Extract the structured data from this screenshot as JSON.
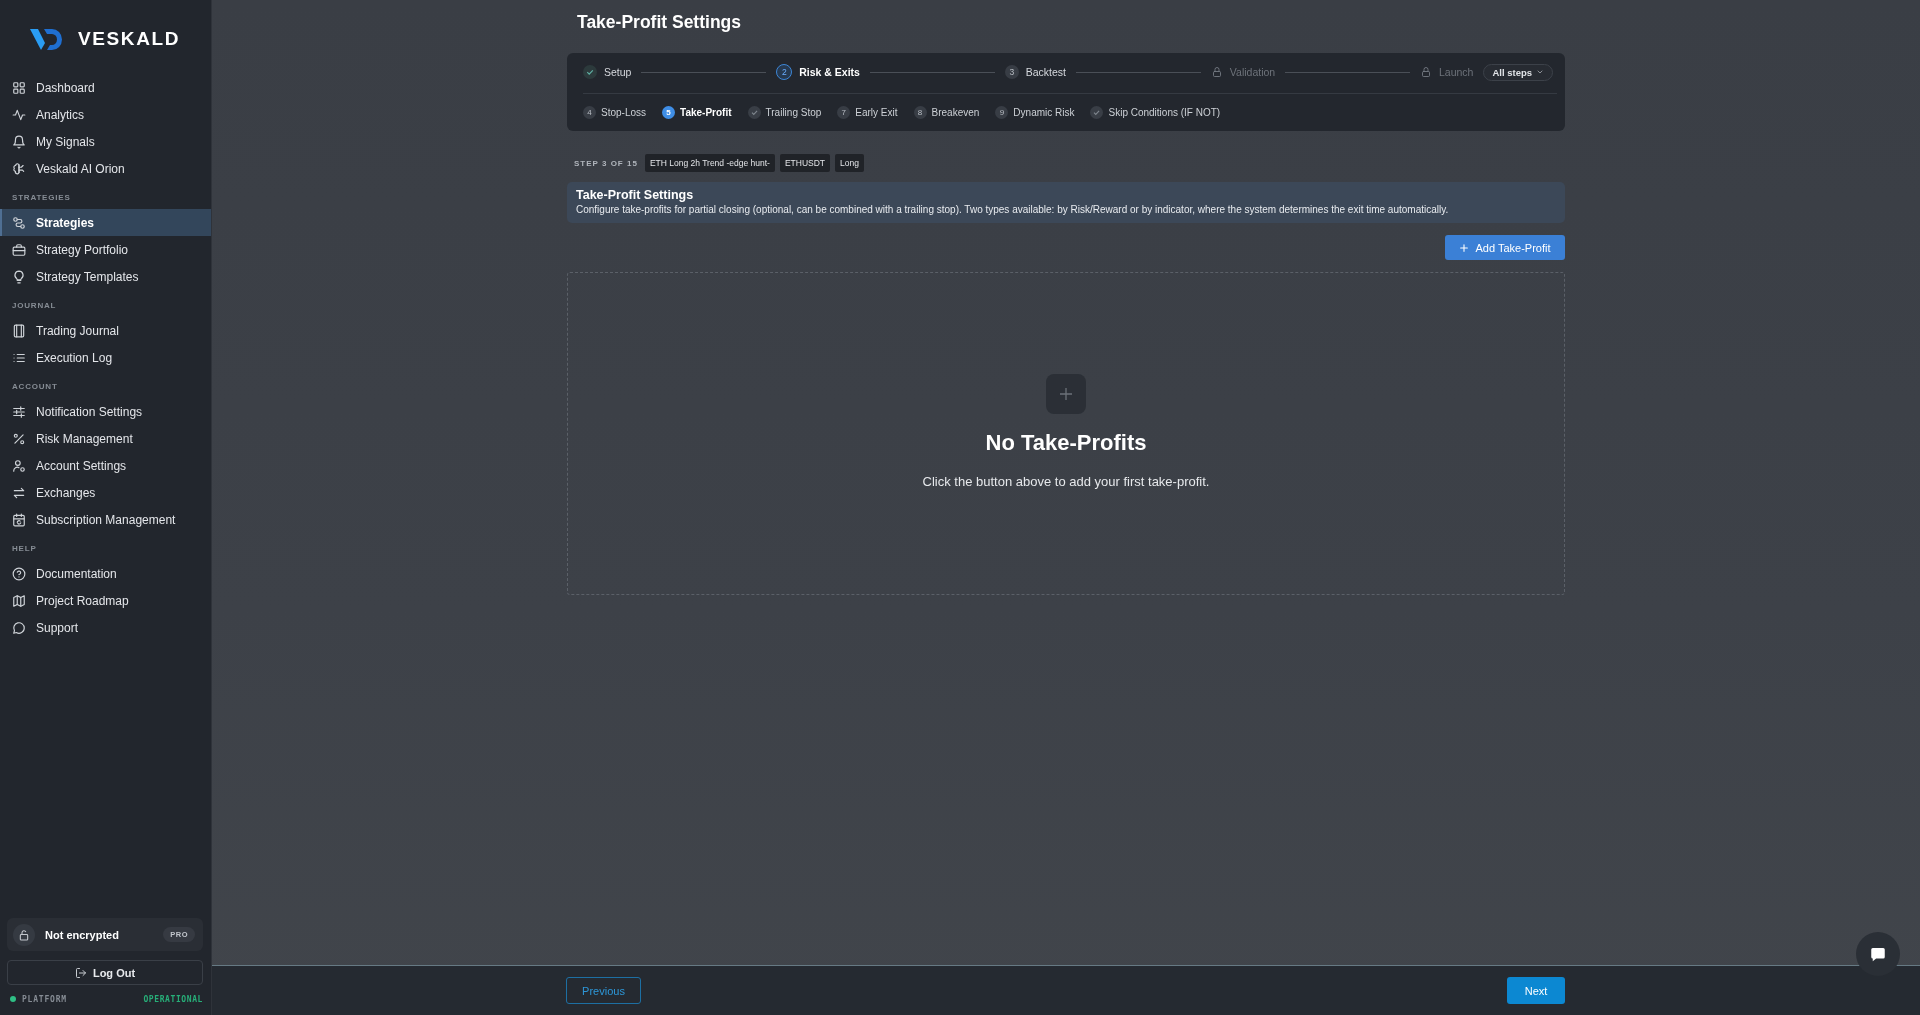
{
  "sidebar": {
    "brand": "VESKALD",
    "sections": [
      {
        "items": [
          {
            "label": "Dashboard",
            "selected": false
          },
          {
            "label": "Analytics",
            "selected": false
          },
          {
            "label": "My Signals",
            "selected": false
          },
          {
            "label": "Veskald AI Orion",
            "selected": false
          }
        ]
      },
      {
        "title": "STRATEGIES",
        "items": [
          {
            "label": "Strategies",
            "selected": true
          },
          {
            "label": "Strategy Portfolio",
            "selected": false
          },
          {
            "label": "Strategy Templates",
            "selected": false
          }
        ]
      },
      {
        "title": "JOURNAL",
        "items": [
          {
            "label": "Trading Journal",
            "selected": false
          },
          {
            "label": "Execution Log",
            "selected": false
          }
        ]
      },
      {
        "title": "ACCOUNT",
        "items": [
          {
            "label": "Notification Settings",
            "selected": false
          },
          {
            "label": "Risk Management",
            "selected": false
          },
          {
            "label": "Account Settings",
            "selected": false
          },
          {
            "label": "Exchanges",
            "selected": false
          },
          {
            "label": "Subscription Management",
            "selected": false
          }
        ]
      },
      {
        "title": "HELP",
        "items": [
          {
            "label": "Documentation",
            "selected": false
          },
          {
            "label": "Project Roadmap",
            "selected": false
          },
          {
            "label": "Support",
            "selected": false
          }
        ]
      }
    ],
    "security": {
      "label": "Not encrypted",
      "plan": "PRO"
    },
    "logout_button": "Log Out",
    "platform": {
      "label": "PLATFORM",
      "status": "OPERATIONAL"
    }
  },
  "page_title": "Take-Profit Settings",
  "stepper": {
    "phases": [
      {
        "label": "Setup",
        "completed": true,
        "locked": false,
        "selected": false
      },
      {
        "number": "2",
        "label": "Risk & Exits",
        "completed": false,
        "locked": false,
        "selected": true
      },
      {
        "number": "3",
        "label": "Backtest",
        "completed": false,
        "locked": false,
        "selected": false
      },
      {
        "label": "Validation",
        "completed": false,
        "locked": true,
        "selected": false
      },
      {
        "label": "Launch",
        "completed": false,
        "locked": true,
        "selected": false
      }
    ],
    "all_steps_button": "All steps",
    "substeps": [
      {
        "number": "4",
        "label": "Stop-Loss",
        "completed": false,
        "selected": false
      },
      {
        "number": "5",
        "label": "Take-Profit",
        "completed": false,
        "selected": true
      },
      {
        "label": "Trailing Stop",
        "completed": true,
        "selected": false
      },
      {
        "number": "7",
        "label": "Early Exit",
        "completed": false,
        "selected": false
      },
      {
        "number": "8",
        "label": "Breakeven",
        "completed": false,
        "selected": false
      },
      {
        "number": "9",
        "label": "Dynamic Risk",
        "completed": false,
        "selected": false
      },
      {
        "label": "Skip Conditions (IF NOT)",
        "completed": true,
        "selected": false
      }
    ]
  },
  "step_info": {
    "counter": "STEP 3 OF 15",
    "tags": [
      "ETH Long 2h Trend -edge hunt-",
      "ETHUSDT",
      "Long"
    ]
  },
  "info_banner": {
    "title": "Take-Profit Settings",
    "description": "Configure take-profits for partial closing (optional, can be combined with a trailing stop). Two types available: by Risk/Reward or by indicator, where the system determines the exit time automatically."
  },
  "add_button": "Add Take-Profit",
  "empty_state": {
    "title": "No Take-Profits",
    "message": "Click the button above to add your first take-profit."
  },
  "footer": {
    "previous_button": "Previous",
    "next_button": "Next"
  }
}
